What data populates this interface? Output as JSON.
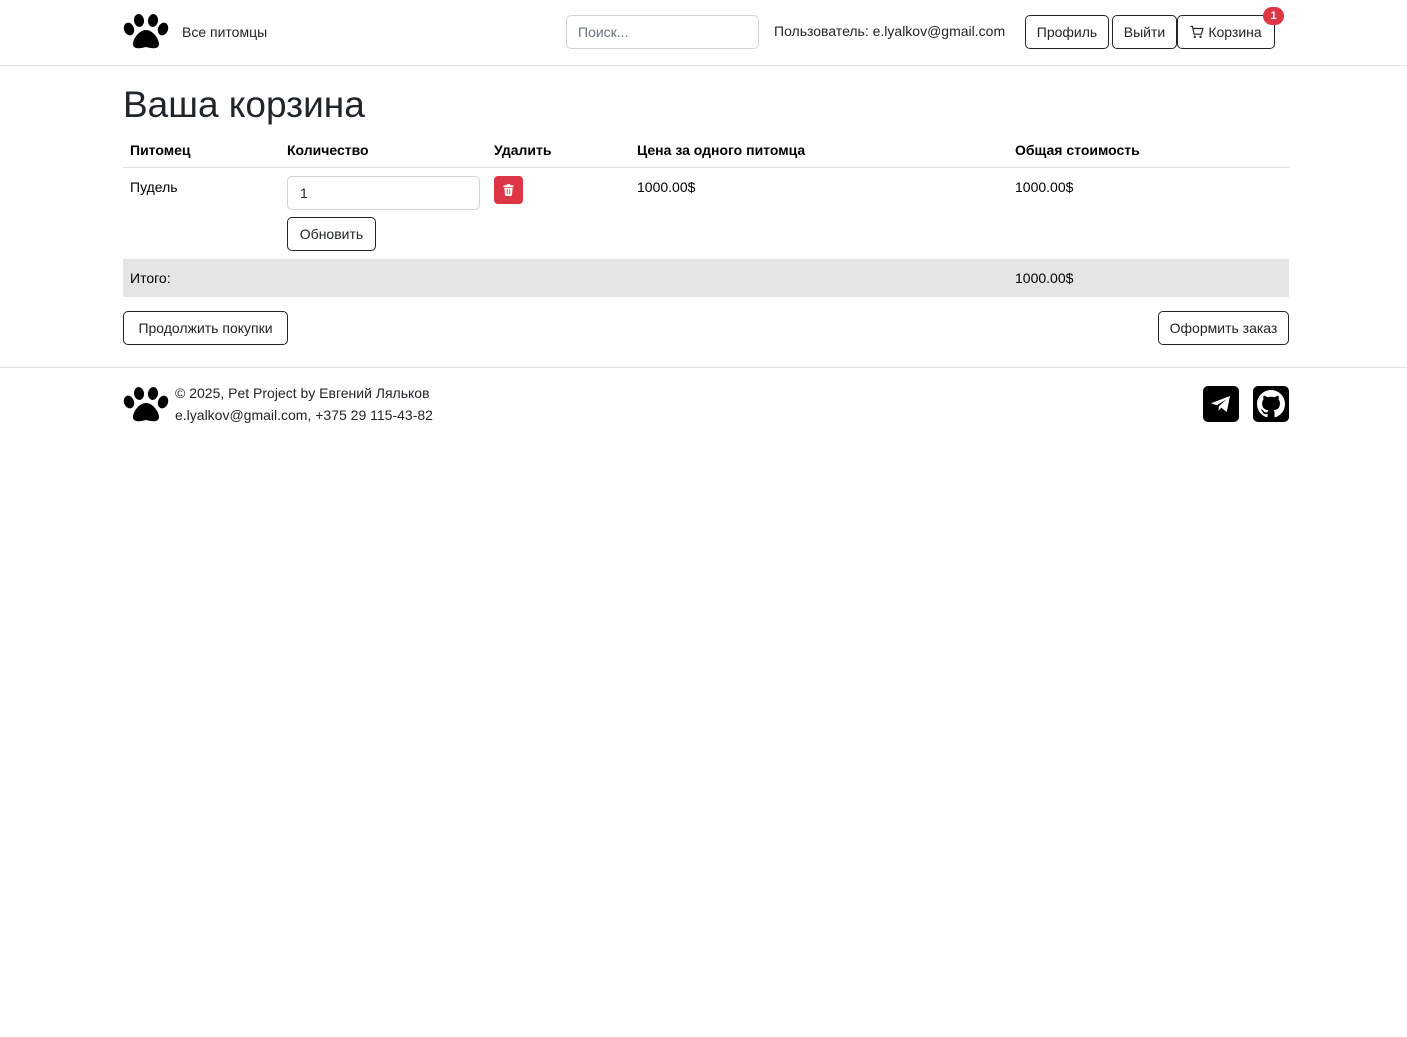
{
  "header": {
    "nav_all_pets": "Все питомцы",
    "search_placeholder": "Поиск...",
    "user_text": "Пользователь: e.lyalkov@gmail.com",
    "profile_label": "Профиль",
    "logout_label": "Выйти",
    "cart_label": "Корзина",
    "cart_count": "1"
  },
  "cart": {
    "title": "Ваша корзина",
    "columns": [
      "Питомец",
      "Количество",
      "Удалить",
      "Цена за одного питомца",
      "Общая стоимость"
    ],
    "items": [
      {
        "pet": "Пудель",
        "quantity": "1",
        "update_label": "Обновить",
        "unit_price": "1000.00$",
        "total": "1000.00$"
      }
    ],
    "total_label": "Итого:",
    "total_value": "1000.00$",
    "continue_label": "Продолжить покупки",
    "checkout_label": "Оформить заказ"
  },
  "footer": {
    "line1": "© 2025, Pet Project by Евгений Ляльков",
    "line2": "e.lyalkov@gmail.com, +375 29 115-43-82"
  },
  "colors": {
    "danger": "#dc3545",
    "border": "#dee2e6",
    "total_row_bg": "#e5e5e5",
    "text": "#212529"
  },
  "icons": [
    "paw-icon",
    "cart-icon",
    "trash-icon",
    "telegram-icon",
    "github-icon"
  ]
}
